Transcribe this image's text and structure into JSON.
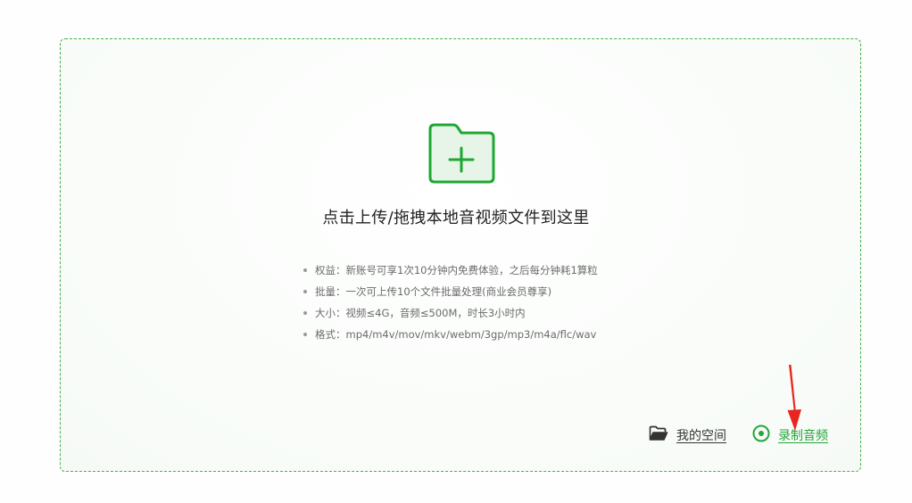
{
  "upload": {
    "prompt": "点击上传/拖拽本地音视频文件到这里",
    "folder_icon": "folder-plus-icon",
    "accent_color": "#1fa732",
    "info_items": [
      "权益：新账号可享1次10分钟内免费体验，之后每分钟耗1算粒",
      "批量：一次可上传10个文件批量处理(商业会员尊享)",
      "大小：视频≤4G，音频≤500M，时长3小时内",
      "格式：mp4/m4v/mov/mkv/webm/3gp/mp3/m4a/flc/wav"
    ]
  },
  "actions": {
    "my_space_label": "我的空间",
    "my_space_icon": "folder-open-icon",
    "record_label": "录制音频",
    "record_icon": "record-radio-icon",
    "record_color": "#26a53a"
  },
  "annotation": {
    "arrow_color": "#e8251e"
  }
}
